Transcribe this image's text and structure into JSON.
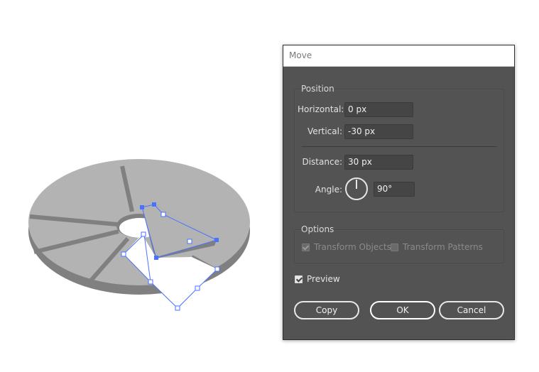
{
  "dialog": {
    "title": "Move",
    "position_group": {
      "label": "Position",
      "horizontal_label": "Horizontal:",
      "horizontal_value": "0 px",
      "vertical_label": "Vertical:",
      "vertical_value": "-30 px",
      "distance_label": "Distance:",
      "distance_value": "30 px",
      "angle_label": "Angle:",
      "angle_value": "90°"
    },
    "options_group": {
      "label": "Options",
      "transform_objects_label": "Transform Objects",
      "transform_objects_checked": true,
      "transform_patterns_label": "Transform Patterns",
      "transform_patterns_checked": false
    },
    "preview_label": "Preview",
    "preview_checked": true,
    "buttons": {
      "copy": "Copy",
      "ok": "OK",
      "cancel": "Cancel"
    }
  },
  "colors": {
    "dialog_bg": "#535353",
    "disk_top": "#b3b3b3",
    "disk_side": "#808080",
    "selection": "#4a72ff"
  }
}
